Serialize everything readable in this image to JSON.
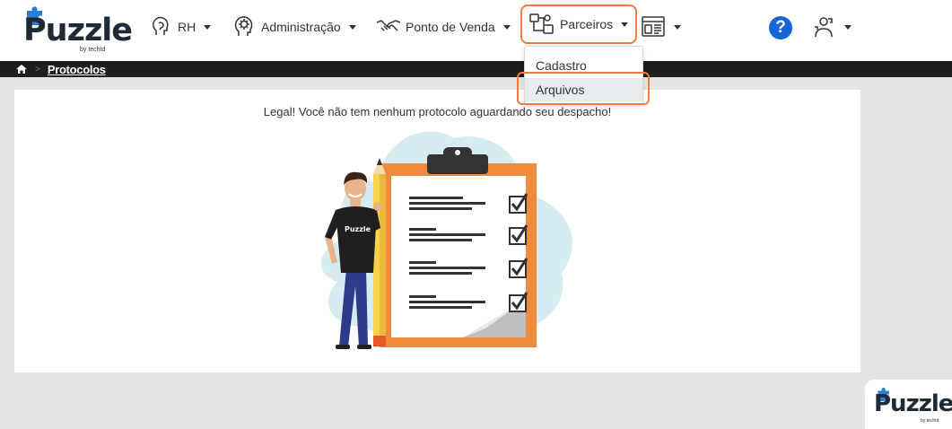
{
  "app": {
    "logo_text": "Puzzle",
    "logo_tagline": "by techtd"
  },
  "nav": {
    "rh": "RH",
    "administracao": "Administração",
    "ponto_de_venda": "Ponto de Venda",
    "parceiros": "Parceiros",
    "help": "?"
  },
  "dropdown": {
    "items": [
      "Cadastro",
      "Arquivos"
    ],
    "selected": "Arquivos"
  },
  "breadcrumb": {
    "current": "Protocolos"
  },
  "main": {
    "message": "Legal! Você não tem nenhum protocolo aguardando seu despacho!",
    "illustration_shirt_text": "Puzzle"
  },
  "colors": {
    "highlight": "#ef7b45",
    "brand_dark": "#1f2a36",
    "brand_blue": "#2a7fd4",
    "help_blue": "#1565d8",
    "breadcrumb_bg": "#1e1e1e",
    "page_bg": "#e5e5e5",
    "clipboard_orange": "#f28a3e"
  },
  "icons": [
    "home-icon",
    "brain-icon",
    "gear-head-icon",
    "handshake-icon",
    "partners-icon",
    "report-icon",
    "user-puzzle-icon",
    "puzzle-piece-icon"
  ]
}
